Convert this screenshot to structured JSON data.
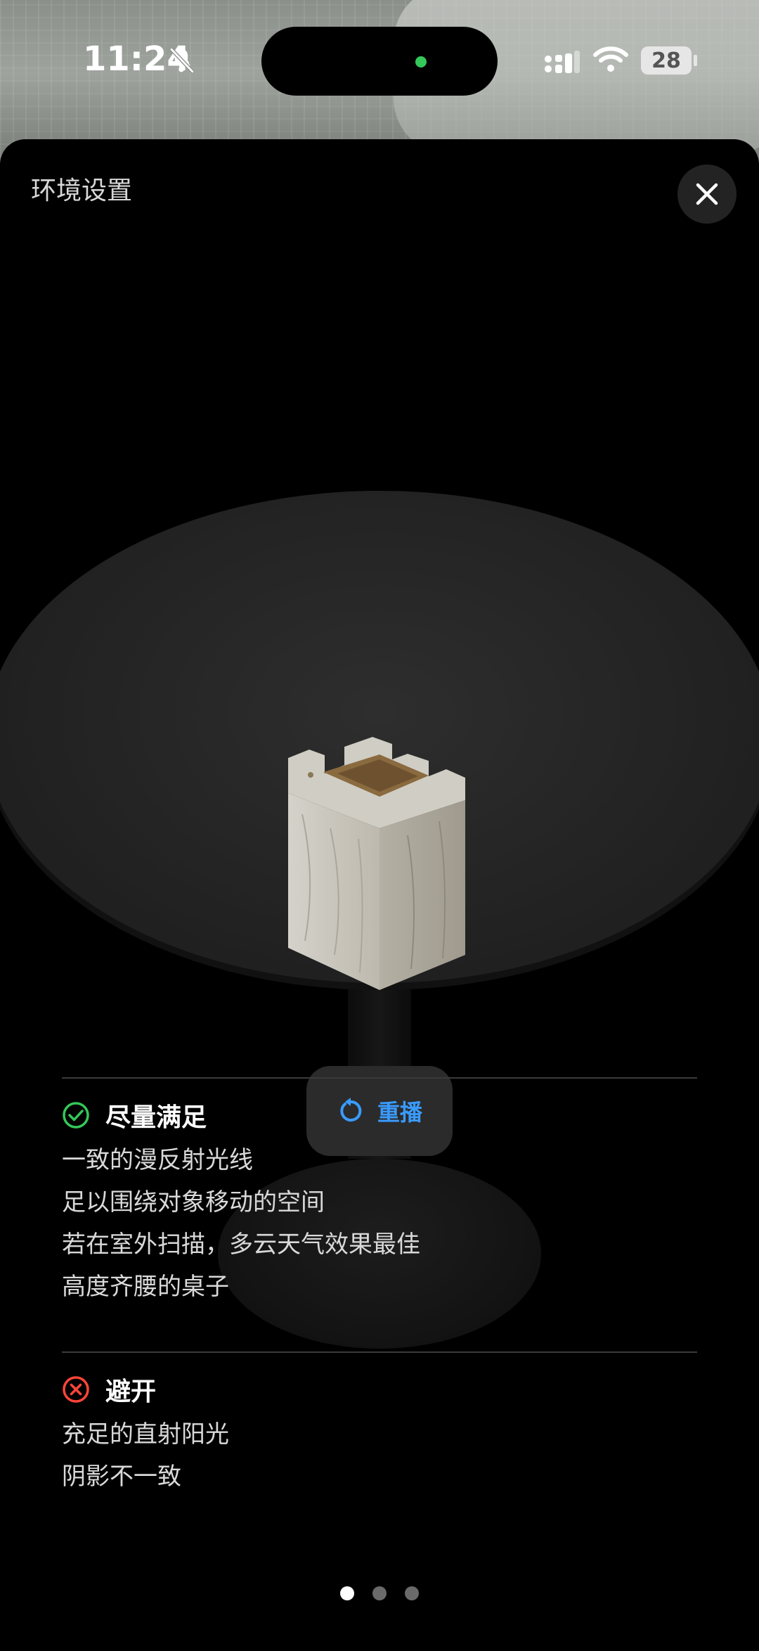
{
  "status": {
    "time": "11:24",
    "battery": "28"
  },
  "sheet": {
    "title": "环境设置"
  },
  "replay": {
    "label": "重播"
  },
  "do_section": {
    "title": "尽量满足",
    "icon": "check-circle-icon",
    "color": "#34c759",
    "items": [
      "一致的漫反射光线",
      "足以围绕对象移动的空间",
      "若在室外扫描，多云天气效果最佳",
      "高度齐腰的桌子"
    ]
  },
  "avoid_section": {
    "title": "避开",
    "icon": "x-circle-icon",
    "color": "#ff453a",
    "items": [
      "充足的直射阳光",
      "阴影不一致"
    ]
  },
  "pagination": {
    "count": 3,
    "active_index": 0
  },
  "accent": "#3a9bff"
}
